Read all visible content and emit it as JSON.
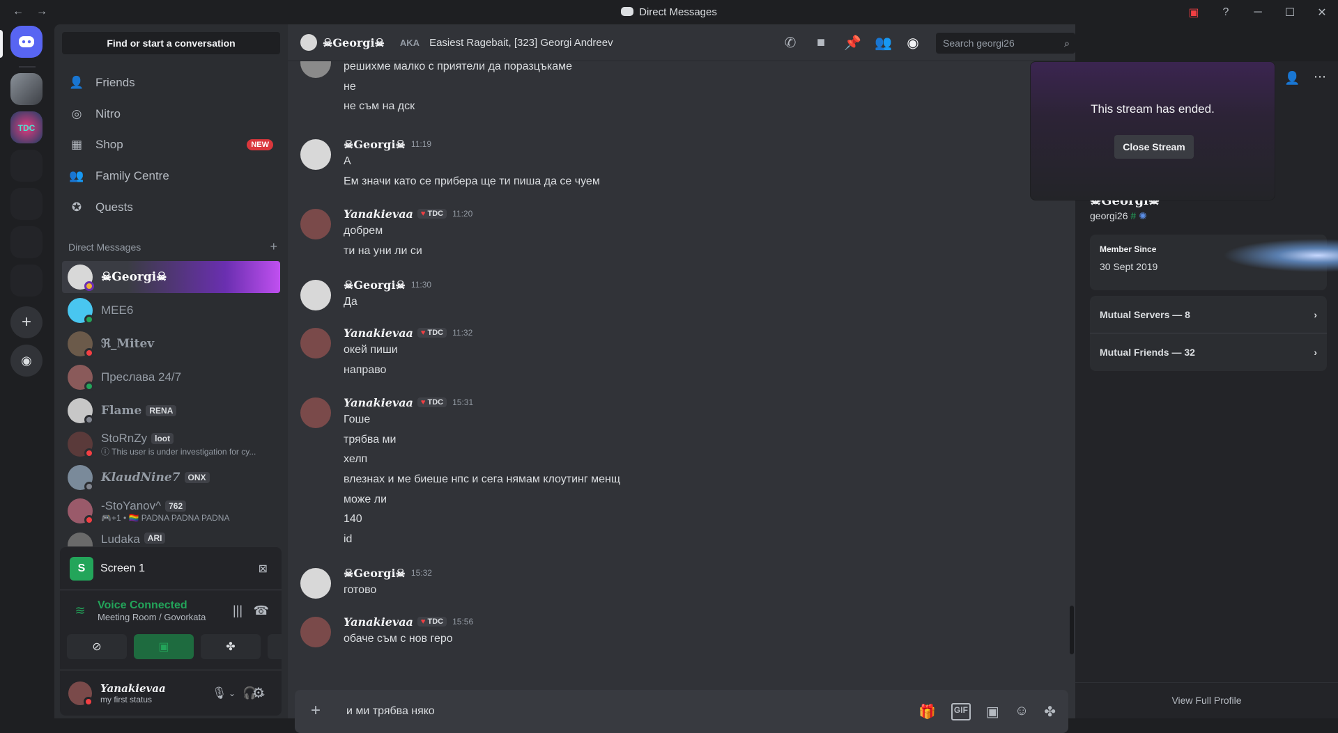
{
  "window": {
    "title": "Direct Messages",
    "back": "←",
    "forward": "→",
    "min": "─",
    "max": "☐",
    "close": "✕"
  },
  "sidebar": {
    "search_label": "Find or start a conversation",
    "nav": [
      {
        "label": "Friends"
      },
      {
        "label": "Nitro"
      },
      {
        "label": "Shop",
        "badge": "NEW"
      },
      {
        "label": "Family Centre"
      },
      {
        "label": "Quests"
      }
    ],
    "dm_header": "Direct Messages",
    "dm_add": "+",
    "dms": [
      {
        "name": "☠Georgi☠"
      },
      {
        "name": "MEE6"
      },
      {
        "name": "ℜ_Mitev"
      },
      {
        "name": "Преслава 24/7"
      },
      {
        "name": "Flame",
        "tag": "RENA"
      },
      {
        "name": "StoRnZy",
        "tag": "loot",
        "sub": "ⓘ This user is under investigation for cy..."
      },
      {
        "name": "KlaudNine7",
        "tag": "ONX"
      },
      {
        "name": "-StoYanov^",
        "tag": "762",
        "sub": "🎮+1 • 🏳️‍🌈 PADNA PADNA PADNA"
      },
      {
        "name": "Ludaka",
        "tag": "ARI"
      }
    ]
  },
  "voice_panel": {
    "screen_title": "Screen 1",
    "screen_icon": "S",
    "status": "Voice Connected",
    "channel": "Meeting Room / Govorkata",
    "user_name": "Yanakievaa",
    "user_status": "my first status"
  },
  "chat": {
    "header_name": "☠Georgi☠",
    "aka_label": "AKA",
    "aka_value": "Easiest Ragebait, [323] Georgi Andreev",
    "search_placeholder": "Search georgi26",
    "messages": [
      {
        "lines": [
          "решихме малко с приятели да поразцъкаме",
          "не",
          "не съм на дск"
        ]
      },
      {
        "author": "☠Georgi☠",
        "time": "11:19",
        "lines": [
          "А",
          "Ем значи като се прибера ще ти пиша да се чуем"
        ]
      },
      {
        "author": "Yanakievaa",
        "tag": "TDC",
        "time": "11:20",
        "lines": [
          "добрем",
          "ти на уни ли си"
        ]
      },
      {
        "author": "☠Georgi☠",
        "time": "11:30",
        "lines": [
          "Да"
        ]
      },
      {
        "author": "Yanakievaa",
        "tag": "TDC",
        "time": "11:32",
        "lines": [
          "окей пиши",
          "направо"
        ]
      },
      {
        "author": "Yanakievaa",
        "tag": "TDC",
        "time": "15:31",
        "lines": [
          "Гоше",
          "трябва ми",
          "хелп",
          "влезнах и ме биеше нпс и сега нямам клоутинг менщ",
          "може ли",
          "140",
          "id"
        ]
      },
      {
        "author": "☠Georgi☠",
        "time": "15:32",
        "lines": [
          "готово"
        ]
      },
      {
        "author": "Yanakievaa",
        "tag": "TDC",
        "time": "15:56",
        "lines": [
          "обаче съм с нов геро"
        ]
      }
    ],
    "input_value": "и  ми трябва някo"
  },
  "profile": {
    "stream_ended": "This stream has ended.",
    "close_stream": "Close Stream",
    "display_name": "☠Georgi☠",
    "username": "georgi26",
    "member_since_label": "Member Since",
    "member_since": "30 Sept 2019",
    "mutual_servers": "Mutual Servers — 8",
    "mutual_friends": "Mutual Friends — 32",
    "view_full": "View Full Profile"
  },
  "colors": {
    "accent": "#5865f2",
    "online": "#23a55a",
    "dnd": "#f23f43",
    "idle": "#f0b232"
  }
}
